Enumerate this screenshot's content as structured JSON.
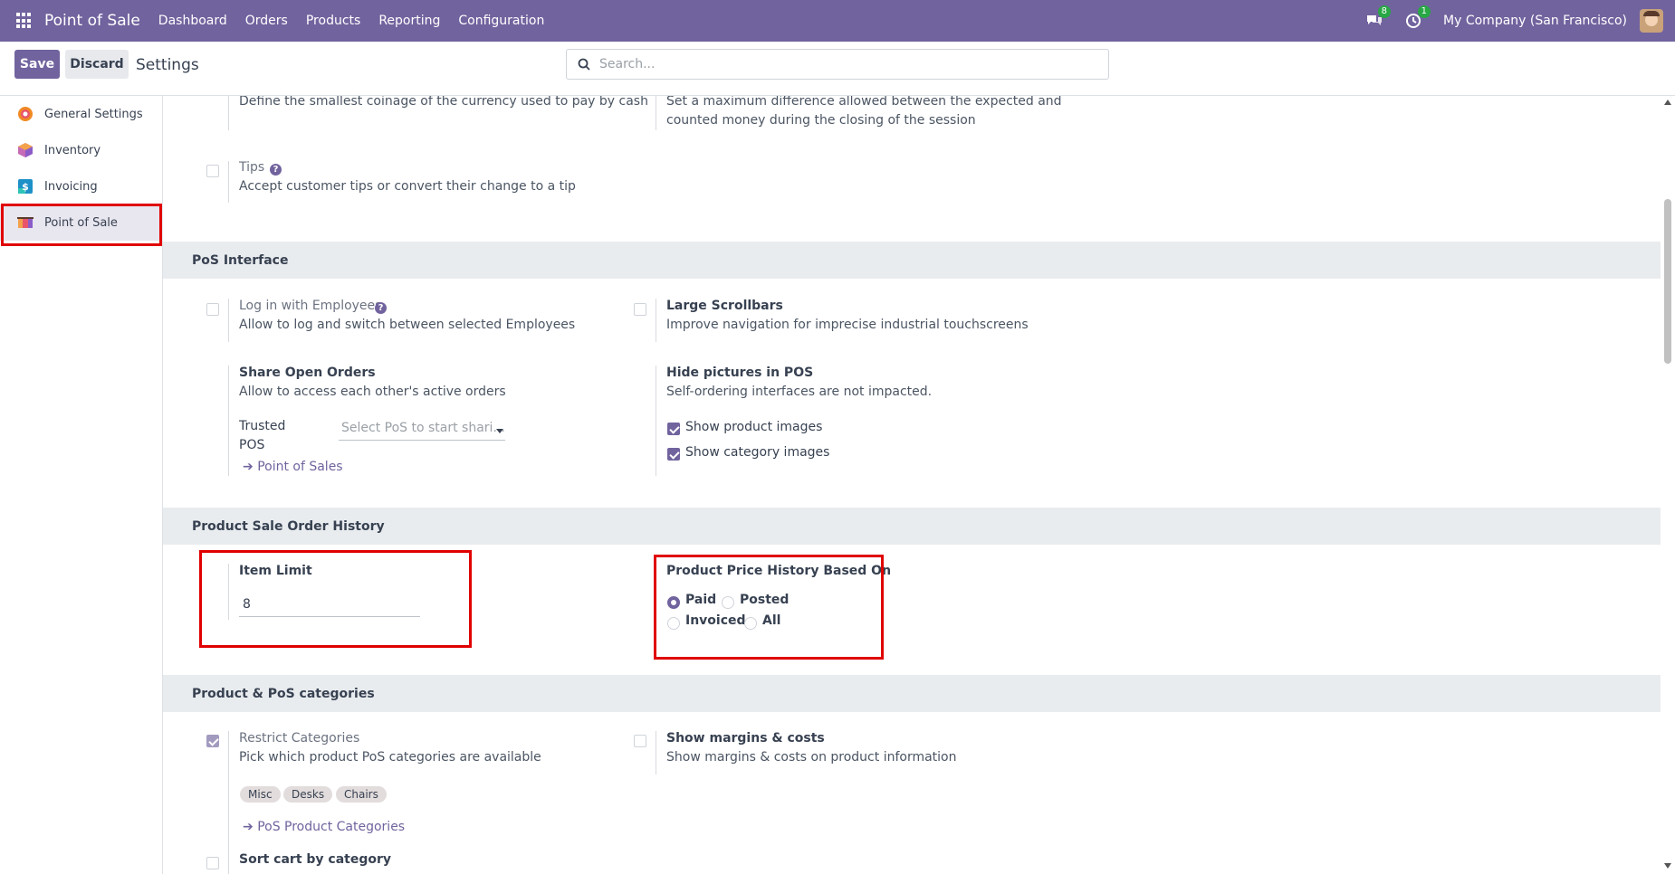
{
  "navbar": {
    "app_name": "Point of Sale",
    "menu": [
      "Dashboard",
      "Orders",
      "Products",
      "Reporting",
      "Configuration"
    ],
    "messages_count": "8",
    "activities_count": "1",
    "company": "My Company (San Francisco)"
  },
  "control": {
    "save_label": "Save",
    "discard_label": "Discard",
    "title": "Settings",
    "search_placeholder": "Search..."
  },
  "sidebar": {
    "items": [
      {
        "label": "General Settings",
        "icon": "general-settings-icon"
      },
      {
        "label": "Inventory",
        "icon": "inventory-icon"
      },
      {
        "label": "Invoicing",
        "icon": "invoicing-icon"
      },
      {
        "label": "Point of Sale",
        "icon": "point-of-sale-icon",
        "active": true
      }
    ]
  },
  "top_settings": {
    "cash_rounding_desc": "Define the smallest coinage of the currency used to pay by cash",
    "cash_control_desc_1": "Set a maximum difference allowed between the expected and",
    "cash_control_desc_2": "counted money during the closing of the session",
    "tips_label": "Tips",
    "tips_desc": "Accept customer tips or convert their change to a tip"
  },
  "pos_interface": {
    "heading": "PoS Interface",
    "login_employees_label": "Log in with Employees",
    "login_employees_desc": "Allow to log and switch between selected Employees",
    "large_scrollbars_label": "Large Scrollbars",
    "large_scrollbars_desc": "Improve navigation for imprecise industrial touchscreens",
    "share_orders_label": "Share Open Orders",
    "share_orders_desc": "Allow to access each other's active orders",
    "trusted_pos_label_1": "Trusted",
    "trusted_pos_label_2": "POS",
    "trusted_pos_placeholder": "Select PoS to start shari...",
    "point_of_sales_link": "Point of Sales",
    "hide_pictures_label": "Hide pictures in POS",
    "hide_pictures_desc": "Self-ordering interfaces are not impacted.",
    "show_product_images_label": "Show product images",
    "show_product_images_checked": true,
    "show_category_images_label": "Show category images",
    "show_category_images_checked": true
  },
  "sale_history": {
    "heading": "Product Sale Order History",
    "item_limit_label": "Item Limit",
    "item_limit_value": "8",
    "price_history_label": "Product Price History Based On",
    "options": [
      "Paid",
      "Posted",
      "Invoiced",
      "All"
    ],
    "selected": "Paid"
  },
  "categories": {
    "heading": "Product & PoS categories",
    "restrict_label": "Restrict Categories",
    "restrict_desc": "Pick which product PoS categories are available",
    "restrict_checked": true,
    "tags": [
      "Misc",
      "Desks",
      "Chairs"
    ],
    "pos_categories_link": "PoS Product Categories",
    "margins_label": "Show margins & costs",
    "margins_desc": "Show margins & costs on product information",
    "sort_cart_label": "Sort cart by category"
  },
  "colors": {
    "brand": "#71639e",
    "highlight": "#e00000",
    "badge": "#28a745"
  }
}
